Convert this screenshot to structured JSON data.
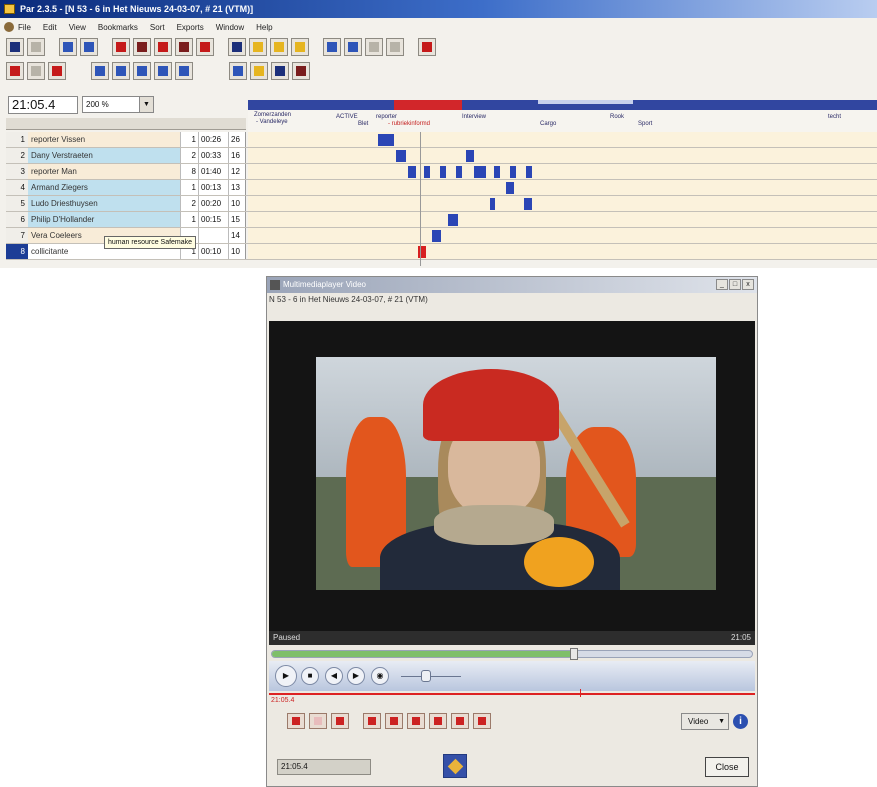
{
  "window": {
    "title": "Par 2.3.5 - [N 53 - 6 in Het Nieuws 24-03-07, # 21 (VTM)]"
  },
  "menu": {
    "items": [
      "File",
      "Edit",
      "View",
      "Bookmarks",
      "Sort",
      "Exports",
      "Window",
      "Help"
    ]
  },
  "toolbar": {
    "time": "21:05.4",
    "zoom": "200 %"
  },
  "timeline": {
    "event_labels": [
      {
        "text": "Zomerzanden",
        "color": "blue"
      },
      {
        "text": "- Vandeleye",
        "color": "blue"
      },
      {
        "text": "ACTIVE",
        "color": "blue"
      },
      {
        "text": "Blet",
        "color": "blue"
      },
      {
        "text": "reporter",
        "color": "blue"
      },
      {
        "text": "- rubriekinformd",
        "color": "red"
      },
      {
        "text": "Interview",
        "color": "blue"
      },
      {
        "text": "Cargo",
        "color": "blue"
      },
      {
        "text": "Rook",
        "color": "blue"
      },
      {
        "text": "Sport",
        "color": "blue"
      },
      {
        "text": "techt",
        "color": "blue"
      }
    ]
  },
  "table": {
    "rows": [
      {
        "num": "1",
        "name": "reporter Vissen",
        "count": "1",
        "dur": "00:26",
        "pct": "26",
        "style": "cream"
      },
      {
        "num": "2",
        "name": "Dany Verstraeten",
        "count": "2",
        "dur": "00:33",
        "pct": "16",
        "style": "blue"
      },
      {
        "num": "3",
        "name": "reporter Man",
        "count": "8",
        "dur": "01:40",
        "pct": "12",
        "style": "cream"
      },
      {
        "num": "4",
        "name": "Armand Ziegers",
        "count": "1",
        "dur": "00:13",
        "pct": "13",
        "style": "blue"
      },
      {
        "num": "5",
        "name": "Ludo Driesthuysen",
        "count": "2",
        "dur": "00:20",
        "pct": "10",
        "style": "blue"
      },
      {
        "num": "6",
        "name": "Philip D'Hollander",
        "count": "1",
        "dur": "00:15",
        "pct": "15",
        "style": "blue"
      },
      {
        "num": "7",
        "name": "Vera Coeleers",
        "count": "",
        "dur": "",
        "pct": "14",
        "style": "cream"
      },
      {
        "num": "8",
        "name": "collicitante",
        "count": "1",
        "dur": "00:10",
        "pct": "10",
        "style": "sel"
      }
    ],
    "tooltip": "human resource Safemake"
  },
  "player": {
    "title": "Multimediaplayer Video",
    "subtitle": "N 53 - 6 in Het Nieuws 24-03-07, # 21 (VTM)",
    "status_left": "Paused",
    "status_right": "21:05",
    "progress_fraction": 0.63,
    "red_time": "21:05.4",
    "video_dropdown": "Video",
    "time_field": "21:05.4",
    "close_label": "Close",
    "window_controls": [
      "_",
      "□",
      "x"
    ]
  }
}
